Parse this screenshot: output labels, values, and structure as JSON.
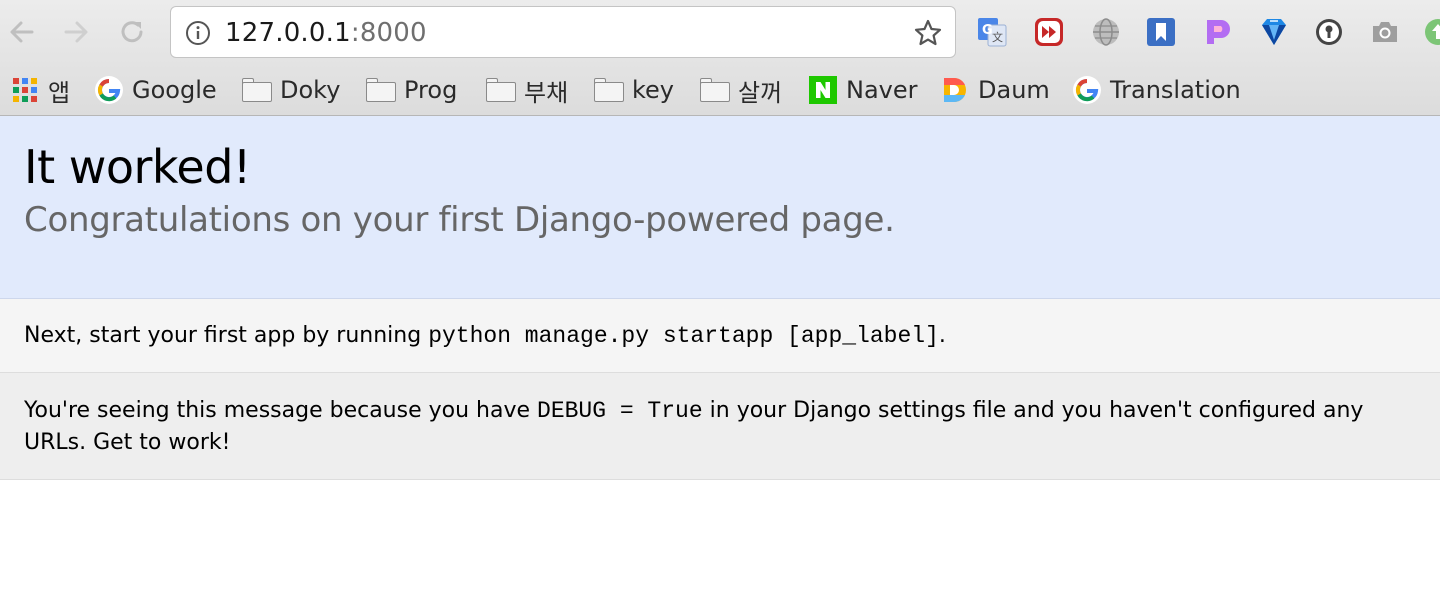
{
  "browser": {
    "url_host": "127.0.0.1",
    "url_port": ":8000",
    "bookmarks": [
      {
        "label": "앱",
        "icon": "apps-grid-icon"
      },
      {
        "label": "Google",
        "icon": "google-icon"
      },
      {
        "label": "Doky",
        "icon": "folder-icon"
      },
      {
        "label": "Prog",
        "icon": "folder-icon"
      },
      {
        "label": "부채",
        "icon": "folder-icon"
      },
      {
        "label": "key",
        "icon": "folder-icon"
      },
      {
        "label": "살꺼",
        "icon": "folder-icon"
      },
      {
        "label": "Naver",
        "icon": "naver-icon"
      },
      {
        "label": "Daum",
        "icon": "daum-icon"
      },
      {
        "label": "Translation",
        "icon": "google-icon"
      }
    ],
    "colors": {
      "accent_google_blue": "#4285f4",
      "naver_green": "#1ec800"
    }
  },
  "page": {
    "title": "It worked!",
    "subtitle": "Congratulations on your first Django-powered page.",
    "instructions": {
      "prefix": "Next, start your first app by running ",
      "code": "python manage.py startapp [app_label]",
      "suffix": "."
    },
    "explanation": {
      "prefix": "You're seeing this message because you have ",
      "code": "DEBUG = True",
      "suffix": " in your Django settings file and you haven't configured any URLs. Get to work!"
    },
    "colors": {
      "summary_bg": "#e1eafc",
      "instructions_bg": "#f5f5f5",
      "explanation_bg": "#eeeeee"
    }
  }
}
